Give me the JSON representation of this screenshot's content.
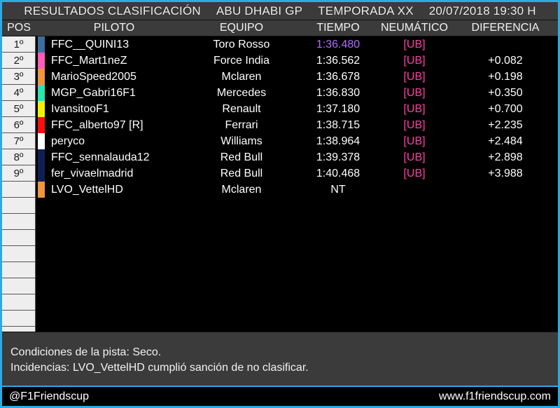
{
  "header": {
    "title": "RESULTADOS CLASIFICACIÓN",
    "grand_prix": "ABU DHABI GP",
    "season": "TEMPORADA XX",
    "datetime": "20/07/2018 19:30 H"
  },
  "columns": {
    "pos": "POS",
    "driver": "PILOTO",
    "team": "EQUIPO",
    "time": "TIEMPO",
    "tyre": "NEUMÁTICO",
    "diff": "DIFERENCIA"
  },
  "colors": {
    "border": "#29ace3",
    "panel": "#3b3b3b",
    "fastest_lap": "#b06cff",
    "tyre": "#ff3fa4",
    "pos_cell_bg": "#eeeeee"
  },
  "rows": [
    {
      "pos": "1º",
      "color": "#3b6e9e",
      "driver": "FFC__QUINI13",
      "team": "Toro Rosso",
      "time": "1:36.480",
      "tyre": "[UB]",
      "diff": "",
      "fastest": true
    },
    {
      "pos": "2º",
      "color": "#ff5cb8",
      "driver": "FFC_Mart1neZ",
      "team": "Force India",
      "time": "1:36.562",
      "tyre": "[UB]",
      "diff": "+0.082",
      "fastest": false
    },
    {
      "pos": "3º",
      "color": "#f09440",
      "driver": "MarioSpeed2005",
      "team": "Mclaren",
      "time": "1:36.678",
      "tyre": "[UB]",
      "diff": "+0.198",
      "fastest": false
    },
    {
      "pos": "4º",
      "color": "#2ce5b0",
      "driver": "MGP_Gabri16F1",
      "team": "Mercedes",
      "time": "1:36.830",
      "tyre": "[UB]",
      "diff": "+0.350",
      "fastest": false
    },
    {
      "pos": "5º",
      "color": "#f7f000",
      "driver": "IvansitooF1",
      "team": "Renault",
      "time": "1:37.180",
      "tyre": "[UB]",
      "diff": "+0.700",
      "fastest": false
    },
    {
      "pos": "6º",
      "color": "#fa0f0f",
      "driver": "FFC_alberto97 [R]",
      "team": "Ferrari",
      "time": "1:38.715",
      "tyre": "[UB]",
      "diff": "+2.235",
      "fastest": false
    },
    {
      "pos": "7º",
      "color": "#ffffff",
      "driver": "peryco",
      "team": "Williams",
      "time": "1:38.964",
      "tyre": "[UB]",
      "diff": "+2.484",
      "fastest": false
    },
    {
      "pos": "8º",
      "color": "#0e1f54",
      "driver": "FFC_sennalauda12",
      "team": "Red Bull",
      "time": "1:39.378",
      "tyre": "[UB]",
      "diff": "+2.898",
      "fastest": false
    },
    {
      "pos": "9º",
      "color": "#0e1f54",
      "driver": "fer_vivaelmadrid",
      "team": "Red Bull",
      "time": "1:40.468",
      "tyre": "[UB]",
      "diff": "+3.988",
      "fastest": false
    },
    {
      "pos": "",
      "color": "#f09440",
      "driver": "LVO_VettelHD",
      "team": "Mclaren",
      "time": "NT",
      "tyre": "",
      "diff": "",
      "fastest": false
    },
    {
      "pos": "",
      "color": "",
      "driver": "",
      "team": "",
      "time": "",
      "tyre": "",
      "diff": "",
      "fastest": false
    },
    {
      "pos": "",
      "color": "",
      "driver": "",
      "team": "",
      "time": "",
      "tyre": "",
      "diff": "",
      "fastest": false
    },
    {
      "pos": "",
      "color": "",
      "driver": "",
      "team": "",
      "time": "",
      "tyre": "",
      "diff": "",
      "fastest": false
    },
    {
      "pos": "",
      "color": "",
      "driver": "",
      "team": "",
      "time": "",
      "tyre": "",
      "diff": "",
      "fastest": false
    },
    {
      "pos": "",
      "color": "",
      "driver": "",
      "team": "",
      "time": "",
      "tyre": "",
      "diff": "",
      "fastest": false
    },
    {
      "pos": "",
      "color": "",
      "driver": "",
      "team": "",
      "time": "",
      "tyre": "",
      "diff": "",
      "fastest": false
    },
    {
      "pos": "",
      "color": "",
      "driver": "",
      "team": "",
      "time": "",
      "tyre": "",
      "diff": "",
      "fastest": false
    },
    {
      "pos": "",
      "color": "",
      "driver": "",
      "team": "",
      "time": "",
      "tyre": "",
      "diff": "",
      "fastest": false
    },
    {
      "pos": "",
      "color": "",
      "driver": "",
      "team": "",
      "time": "",
      "tyre": "",
      "diff": "",
      "fastest": false
    },
    {
      "pos": "",
      "color": "",
      "driver": "",
      "team": "",
      "time": "",
      "tyre": "",
      "diff": "",
      "fastest": false
    }
  ],
  "info": {
    "conditions": "Condiciones de la pista: Seco.",
    "incidents": "Incidencias: LVO_VettelHD cumplió sanción de no clasificar."
  },
  "footer": {
    "social": "@F1Friendscup",
    "website": "www.f1friendscup.com"
  }
}
